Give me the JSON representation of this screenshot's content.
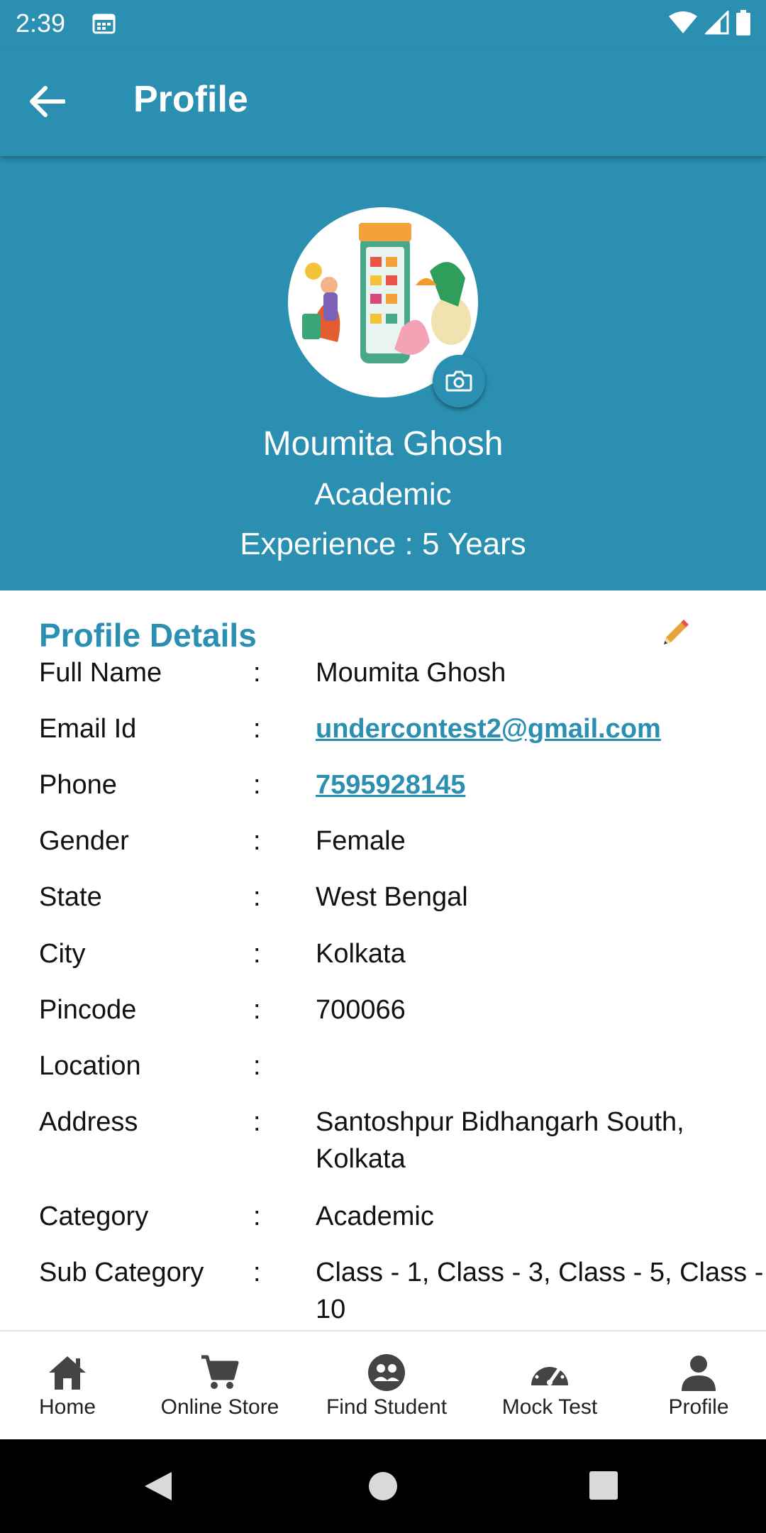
{
  "status_bar": {
    "time": "2:39"
  },
  "app_bar": {
    "title": "Profile"
  },
  "header": {
    "name": "Moumita Ghosh",
    "category": "Academic",
    "experience": "Experience : 5 Years"
  },
  "details": {
    "title": "Profile Details",
    "separator": ":",
    "rows": [
      {
        "label": "Full Name",
        "value": "Moumita Ghosh"
      },
      {
        "label": "Email Id",
        "value": "undercontest2@gmail.com"
      },
      {
        "label": "Phone",
        "value": "7595928145"
      },
      {
        "label": "Gender",
        "value": "Female"
      },
      {
        "label": "State",
        "value": "West Bengal"
      },
      {
        "label": "City",
        "value": "Kolkata"
      },
      {
        "label": "Pincode",
        "value": "700066"
      },
      {
        "label": "Location",
        "value": ""
      },
      {
        "label": "Address",
        "value": "Santoshpur Bidhangarh South, Kolkata"
      },
      {
        "label": "Category",
        "value": "Academic"
      },
      {
        "label": "Sub Category",
        "value": "Class - 1, Class - 3, Class - 5, Class - 10"
      }
    ]
  },
  "bottom_nav": {
    "items": [
      {
        "label": "Home",
        "icon": "home-icon"
      },
      {
        "label": "Online Store",
        "icon": "cart-icon"
      },
      {
        "label": "Find Student",
        "icon": "find-student-icon"
      },
      {
        "label": "Mock Test",
        "icon": "speedometer-icon"
      },
      {
        "label": "Profile",
        "icon": "person-icon"
      }
    ]
  },
  "colors": {
    "primary": "#2a8fb0",
    "edit": "#e8a33b"
  }
}
